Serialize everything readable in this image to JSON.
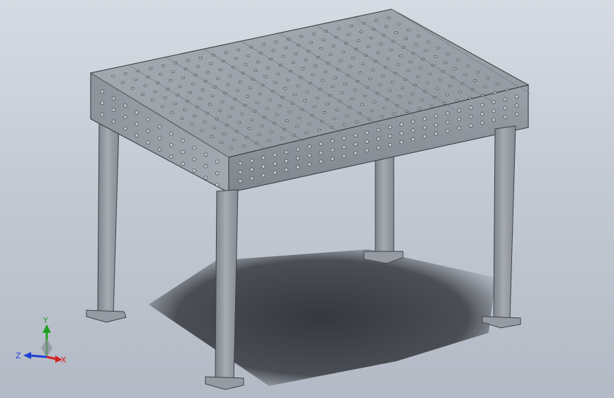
{
  "viewport": {
    "background_top": "#d6dbe3",
    "background_bottom": "#b3bac5"
  },
  "model": {
    "name_icon": "welding-table-3d-model",
    "top_color": "#9aa0a8",
    "side_color": "#8a9098",
    "hole_color": "#4a4e55",
    "leg_color": "#8e939b",
    "shadow_color": "#3a3d42"
  },
  "triad": {
    "x_label": "X",
    "y_label": "Y",
    "z_label": "Z",
    "x_color": "#d62020",
    "y_color": "#1fa01f",
    "z_color": "#1f3fd6"
  }
}
